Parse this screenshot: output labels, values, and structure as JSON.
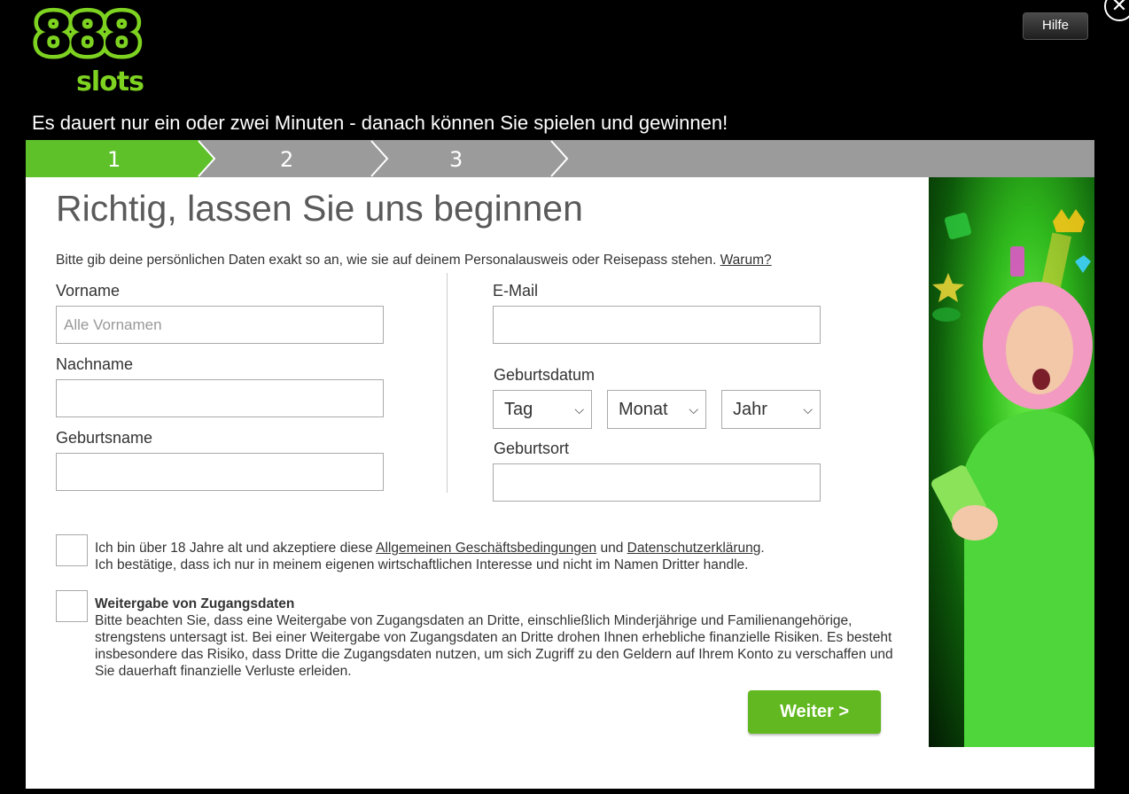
{
  "brand": {
    "logo_top": "888",
    "logo_bottom": "slots",
    "accent": "#7ed321"
  },
  "header": {
    "help_label": "Hilfe",
    "close_glyph": "✕",
    "tagline": "Es dauert nur ein oder zwei Minuten - danach können Sie spielen und gewinnen!"
  },
  "stepper": {
    "steps": [
      "1",
      "2",
      "3"
    ],
    "active_step": 1,
    "active_color": "#5ec12a",
    "inactive_color": "#9b9b9b"
  },
  "form": {
    "title": "Richtig, lassen Sie uns beginnen",
    "intro": "Bitte gib deine persönlichen Daten exakt so an, wie sie auf deinem Personalausweis oder Reisepass stehen.",
    "intro_link": "Warum?",
    "first_name": {
      "label": "Vorname",
      "placeholder": "Alle Vornamen",
      "value": ""
    },
    "last_name": {
      "label": "Nachname",
      "placeholder": "",
      "value": ""
    },
    "birth_name": {
      "label": "Geburtsname",
      "placeholder": "",
      "value": ""
    },
    "email": {
      "label": "E-Mail",
      "placeholder": "",
      "value": ""
    },
    "birth_date": {
      "label": "Geburtsdatum",
      "day": "Tag",
      "month": "Monat",
      "year": "Jahr"
    },
    "birth_place": {
      "label": "Geburtsort",
      "placeholder": "",
      "value": ""
    }
  },
  "consent": {
    "age_pre": "Ich bin über 18 Jahre alt und akzeptiere diese ",
    "terms_link": "Allgemeinen Geschäftsbedingungen",
    "age_mid": " und ",
    "privacy_link": "Datenschutzerklärung",
    "age_post": ".",
    "age_line2": "Ich bestätige, dass ich nur in meinem eigenen wirtschaftlichen Interesse und nicht im Namen Dritter handle.",
    "sharing_title": "Weitergabe von Zugangsdaten",
    "sharing_text": "Bitte beachten Sie, dass eine Weitergabe von Zugangsdaten an Dritte, einschließlich Minderjährige und Familienangehörige, strengstens untersagt ist. Bei einer Weitergabe von Zugangsdaten an Dritte drohen Ihnen erhebliche finanzielle Risiken. Es besteht insbesondere das Risiko, dass Dritte die Zugangsdaten nutzen, um sich Zugriff zu den Geldern auf Ihrem Konto zu verschaffen und Sie dauerhaft finanzielle Verluste erleiden."
  },
  "actions": {
    "next_label": "Weiter >",
    "next_color": "#62b820"
  }
}
